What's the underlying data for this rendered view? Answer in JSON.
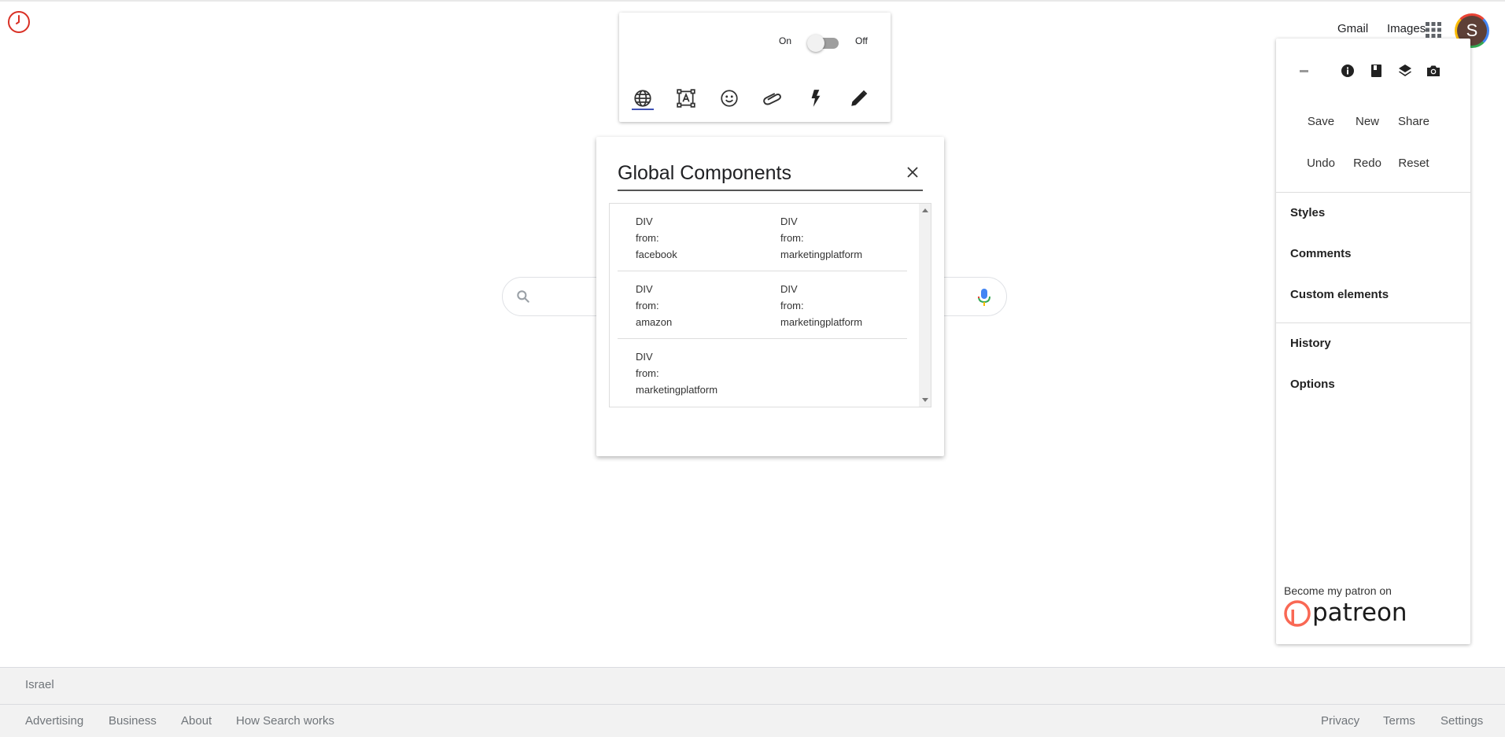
{
  "google_header": {
    "gmail": "Gmail",
    "images": "Images",
    "avatar_initial": "S",
    "apps_icon": "grid-icon"
  },
  "toolbar": {
    "toggle_on_label": "On",
    "toggle_off_label": "Off",
    "toggle_state": "off",
    "icons": [
      "globe-icon",
      "text-box-icon",
      "smiley-icon",
      "attachment-icon",
      "lightning-icon",
      "pencil-icon"
    ],
    "active_icon": "globe-icon"
  },
  "dialog": {
    "title": "Global Components",
    "rows": [
      [
        {
          "tag": "DIV",
          "from_label": "from:",
          "source": "facebook"
        },
        {
          "tag": "DIV",
          "from_label": "from:",
          "source": "marketingplatform"
        }
      ],
      [
        {
          "tag": "DIV",
          "from_label": "from:",
          "source": "amazon"
        },
        {
          "tag": "DIV",
          "from_label": "from:",
          "source": "marketingplatform"
        }
      ],
      [
        {
          "tag": "DIV",
          "from_label": "from:",
          "source": "marketingplatform"
        }
      ]
    ]
  },
  "side_panel": {
    "top_icons": [
      "minimize-icon",
      "info-icon",
      "book-icon",
      "layers-icon",
      "camera-icon"
    ],
    "actions_row1": [
      "Save",
      "New",
      "Share"
    ],
    "actions_row2": [
      "Undo",
      "Redo",
      "Reset"
    ],
    "menu_group1": [
      "Styles",
      "Comments",
      "Custom elements"
    ],
    "menu_group2": [
      "History",
      "Options"
    ],
    "patreon_text": "Become my patron on",
    "patreon_word": "patreon"
  },
  "footer": {
    "country": "Israel",
    "left_links": [
      "Advertising",
      "Business",
      "About",
      "How Search works"
    ],
    "right_links": [
      "Privacy",
      "Terms",
      "Settings"
    ]
  },
  "colors": {
    "accent_underline": "#3f51b5",
    "patreon_orange": "#f96854",
    "clock_red": "#d93025"
  }
}
